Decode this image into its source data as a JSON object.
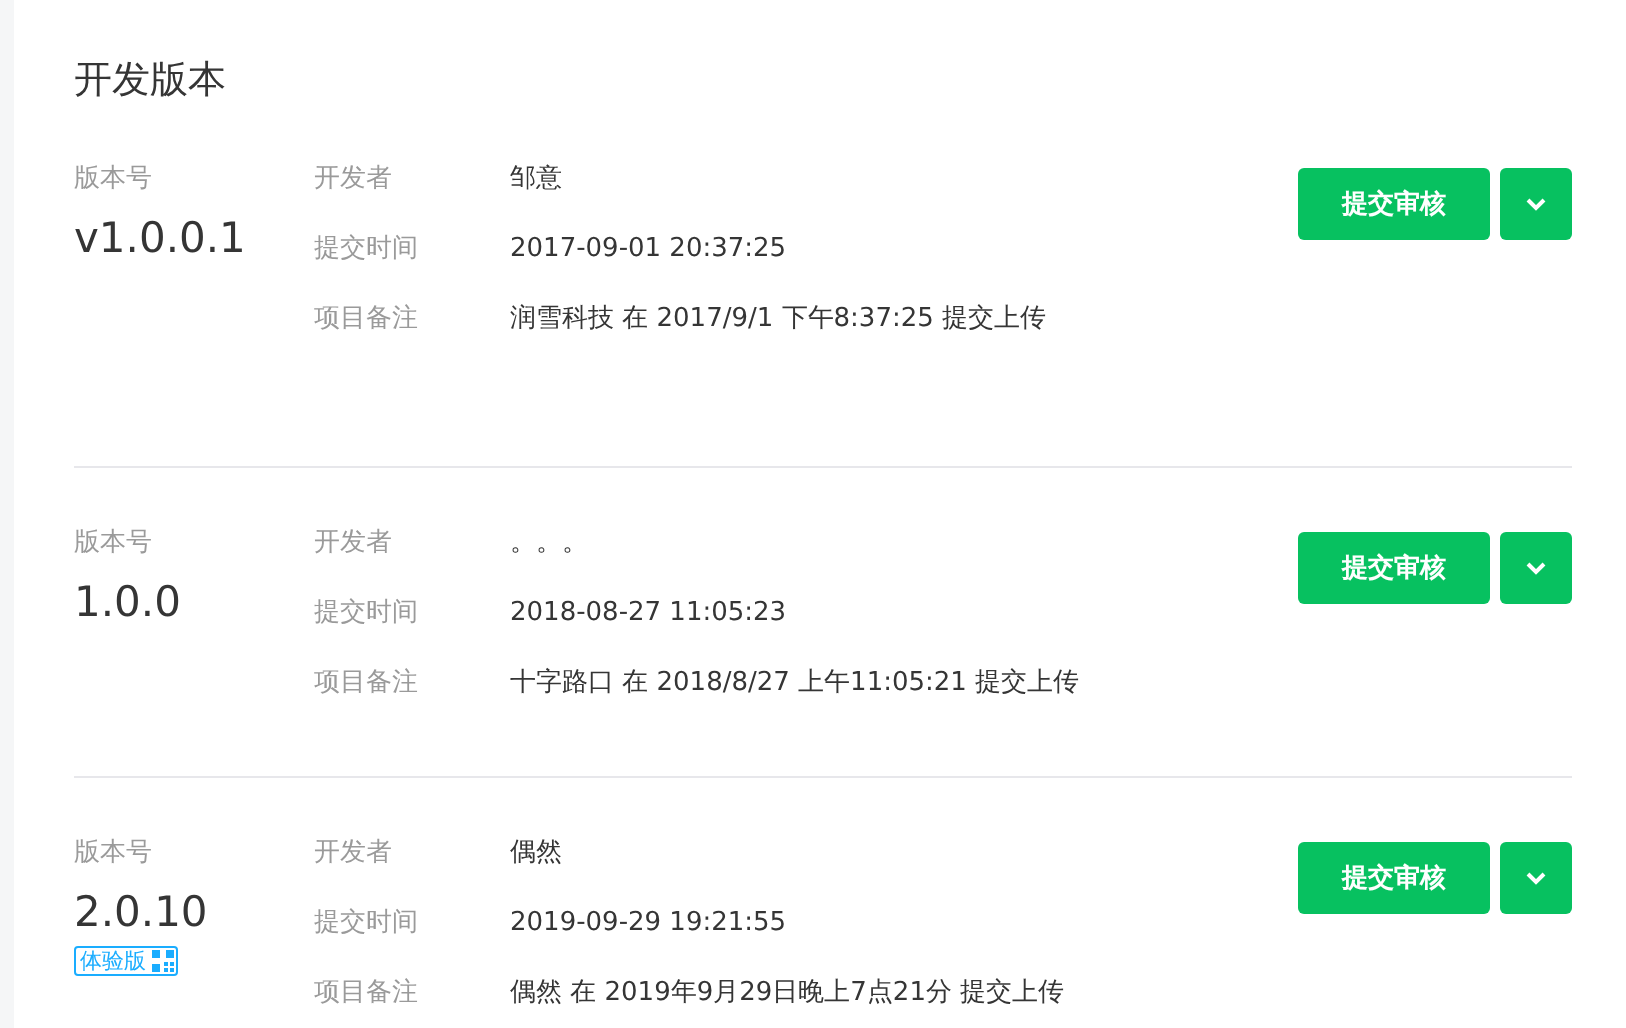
{
  "title": "开发版本",
  "versions": [
    {
      "version_label": "版本号",
      "version": "v1.0.0.1",
      "fields": [
        {
          "label": "开发者",
          "value": "邹意"
        },
        {
          "label": "提交时间",
          "value": "2017-09-01 20:37:25"
        },
        {
          "label": "项目备注",
          "value": "润雪科技 在 2017/9/1 下午8:37:25 提交上传"
        }
      ],
      "submit_button": "提交审核"
    },
    {
      "version_label": "版本号",
      "version": "1.0.0",
      "fields": [
        {
          "label": "开发者",
          "value": "。。。"
        },
        {
          "label": "提交时间",
          "value": "2018-08-27 11:05:23"
        },
        {
          "label": "项目备注",
          "value": "十字路口 在 2018/8/27 上午11:05:21 提交上传"
        }
      ],
      "submit_button": "提交审核"
    },
    {
      "version_label": "版本号",
      "version": "2.0.10",
      "badge": "体验版",
      "fields": [
        {
          "label": "开发者",
          "value": "偶然"
        },
        {
          "label": "提交时间",
          "value": "2019-09-29 19:21:55"
        },
        {
          "label": "项目备注",
          "value": "偶然 在 2019年9月29日晚上7点21分 提交上传"
        }
      ],
      "submit_button": "提交审核"
    }
  ]
}
